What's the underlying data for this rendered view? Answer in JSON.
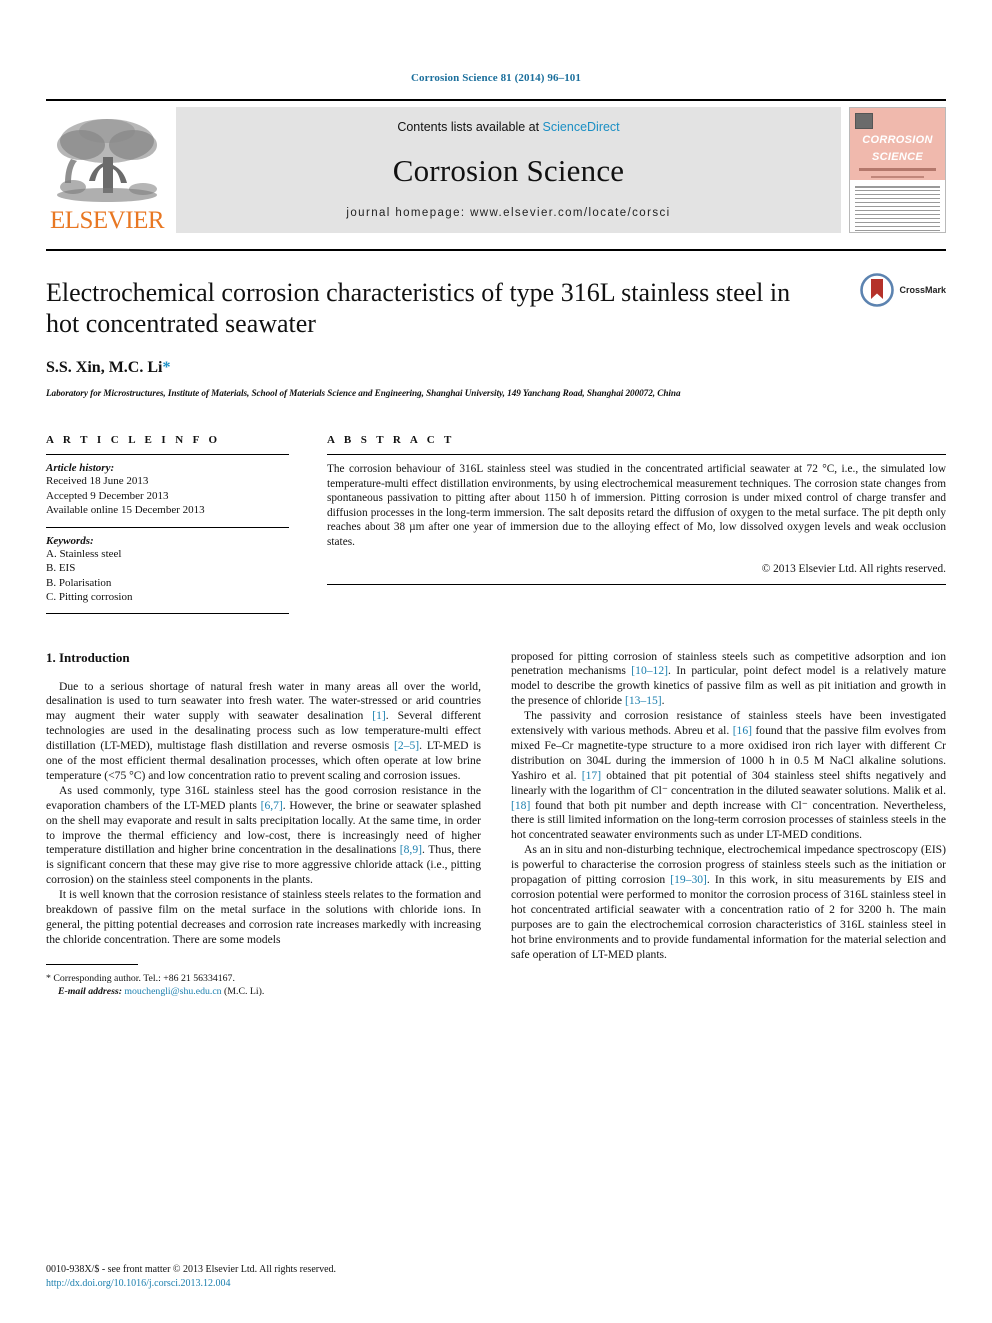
{
  "running_head": "Corrosion Science 81 (2014) 96–101",
  "masthead": {
    "publisher_name": "ELSEVIER",
    "contents_prefix": "Contents lists available at ",
    "sciencedirect": "ScienceDirect",
    "journal_name": "Corrosion Science",
    "homepage": "journal homepage: www.elsevier.com/locate/corsci",
    "cover": {
      "title_line1": "CORROSION",
      "title_line2": "SCIENCE"
    }
  },
  "article": {
    "title": "Electrochemical corrosion characteristics of type 316L stainless steel in hot concentrated seawater",
    "authors": "S.S. Xin, M.C. Li",
    "author_marker": "*",
    "affiliation": "Laboratory for Microstructures, Institute of Materials, School of Materials Science and Engineering, Shanghai University, 149 Yanchang Road, Shanghai 200072, China",
    "crossmark_label": "CrossMark"
  },
  "article_info": {
    "heading": "A R T I C L E   I N F O",
    "history_label": "Article history:",
    "history": [
      "Received 18 June 2013",
      "Accepted 9 December 2013",
      "Available online 15 December 2013"
    ],
    "keywords_label": "Keywords:",
    "keywords": [
      "A. Stainless steel",
      "B. EIS",
      "B. Polarisation",
      "C. Pitting corrosion"
    ]
  },
  "abstract": {
    "heading": "A B S T R A C T",
    "body": "The corrosion behaviour of 316L stainless steel was studied in the concentrated artificial seawater at 72 °C, i.e., the simulated low temperature-multi effect distillation environments, by using electrochemical measurement techniques. The corrosion state changes from spontaneous passivation to pitting after about 1150 h of immersion. Pitting corrosion is under mixed control of charge transfer and diffusion processes in the long-term immersion. The salt deposits retard the diffusion of oxygen to the metal surface. The pit depth only reaches about 38 µm after one year of immersion due to the alloying effect of Mo, low dissolved oxygen levels and weak occlusion states.",
    "copyright": "© 2013 Elsevier Ltd. All rights reserved."
  },
  "introduction": {
    "heading": "1. Introduction",
    "paragraphs": [
      {
        "parts": [
          {
            "t": "Due to a serious shortage of natural fresh water in many areas all over the world, desalination is used to turn seawater into fresh water. The water-stressed or arid countries may augment their water supply with seawater desalination "
          },
          {
            "t": "[1]",
            "ref": true
          },
          {
            "t": ". Several different technologies are used in the desalinating process such as low temperature-multi effect distillation (LT-MED), multistage flash distillation and reverse osmosis "
          },
          {
            "t": "[2–5]",
            "ref": true
          },
          {
            "t": ". LT-MED is one of the most efficient thermal desalination processes, which often operate at low brine temperature (<75 °C) and low concentration ratio to prevent scaling and corrosion issues."
          }
        ]
      },
      {
        "parts": [
          {
            "t": "As used commonly, type 316L stainless steel has the good corrosion resistance in the evaporation chambers of the LT-MED plants "
          },
          {
            "t": "[6,7]",
            "ref": true
          },
          {
            "t": ". However, the brine or seawater splashed on the shell may evaporate and result in salts precipitation locally. At the same time, in order to improve the thermal efficiency and low-cost, there is increasingly need of higher temperature distillation and higher brine concentration in the desalinations "
          },
          {
            "t": "[8,9]",
            "ref": true
          },
          {
            "t": ". Thus, there is significant concern that these may give rise to more aggressive chloride attack (i.e., pitting corrosion) on the stainless steel components in the plants."
          }
        ]
      },
      {
        "parts": [
          {
            "t": "It is well known that the corrosion resistance of stainless steels relates to the formation and breakdown of passive film on the metal surface in the solutions with chloride ions. In general, the pitting potential decreases and corrosion rate increases markedly with increasing the chloride concentration. There are some models"
          }
        ]
      }
    ],
    "right_paragraphs": [
      {
        "parts": [
          {
            "t": "proposed for pitting corrosion of stainless steels such as competitive adsorption and ion penetration mechanisms "
          },
          {
            "t": "[10–12]",
            "ref": true
          },
          {
            "t": ". In particular, point defect model is a relatively mature model to describe the growth kinetics of passive film as well as pit initiation and growth in the presence of chloride "
          },
          {
            "t": "[13–15]",
            "ref": true
          },
          {
            "t": "."
          }
        ],
        "noindent": true
      },
      {
        "parts": [
          {
            "t": "The passivity and corrosion resistance of stainless steels have been investigated extensively with various methods. Abreu et al. "
          },
          {
            "t": "[16]",
            "ref": true
          },
          {
            "t": " found that the passive film evolves from mixed Fe–Cr magnetite-type structure to a more oxidised iron rich layer with different Cr distribution on 304L during the immersion of 1000 h in 0.5 M NaCl alkaline solutions. Yashiro et al. "
          },
          {
            "t": "[17]",
            "ref": true
          },
          {
            "t": " obtained that pit potential of 304 stainless steel shifts negatively and linearly with the logarithm of Cl⁻ concentration in the diluted seawater solutions. Malik et al. "
          },
          {
            "t": "[18]",
            "ref": true
          },
          {
            "t": " found that both pit number and depth increase with Cl⁻ concentration. Nevertheless, there is still limited information on the long-term corrosion processes of stainless steels in the hot concentrated seawater environments such as under LT-MED conditions."
          }
        ]
      },
      {
        "parts": [
          {
            "t": "As an in situ and non-disturbing technique, electrochemical impedance spectroscopy (EIS) is powerful to characterise the corrosion progress of stainless steels such as the initiation or propagation of pitting corrosion "
          },
          {
            "t": "[19–30]",
            "ref": true
          },
          {
            "t": ". In this work, in situ measurements by EIS and corrosion potential were performed to monitor the corrosion process of 316L stainless steel in hot concentrated artificial seawater with a concentration ratio of 2 for 3200 h. The main purposes are to gain the electrochemical corrosion characteristics of 316L stainless steel in hot brine environments and to provide fundamental information for the material selection and safe operation of LT-MED plants."
          }
        ]
      }
    ]
  },
  "footnote": {
    "marker": "*",
    "corresponding": "Corresponding author. Tel.: +86 21 56334167.",
    "email_label": "E-mail address:",
    "email": "mouchengli@shu.edu.cn",
    "email_suffix": "(M.C. Li)."
  },
  "footer": {
    "issn_line": "0010-938X/$ - see front matter © 2013 Elsevier Ltd. All rights reserved.",
    "doi": "http://dx.doi.org/10.1016/j.corsci.2013.12.004"
  },
  "colors": {
    "link": "#1b7fae",
    "sciencedirect": "#1b8fc4",
    "elsevier_orange": "#E87722",
    "running_head": "#1b6f9c"
  }
}
